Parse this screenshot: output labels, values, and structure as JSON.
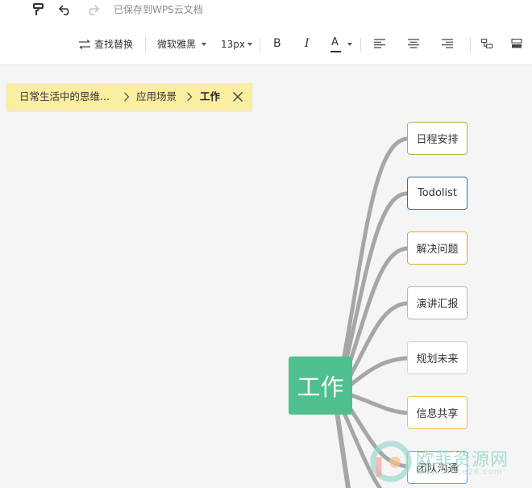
{
  "topbar": {
    "save_status": "已保存到WPS云文档",
    "icons": [
      "format-painter-icon",
      "undo-icon",
      "redo-icon"
    ]
  },
  "toolbar": {
    "find_replace": "查找替换",
    "font_family": "微软雅黑",
    "font_size": "13px",
    "bold": "B",
    "italic": "I",
    "font_color": "A",
    "font_color_value": "#333333"
  },
  "breadcrumb": {
    "items": [
      "日常生活中的思维...",
      "应用场景",
      "工作"
    ]
  },
  "mindmap": {
    "root": "工作",
    "root_color": "#4fc08d",
    "children": [
      {
        "label": "日程安排",
        "color": "#8cc63f"
      },
      {
        "label": "Todolist",
        "color": "#2f6ea5"
      },
      {
        "label": "解决问题",
        "color": "#e3a03a"
      },
      {
        "label": "演讲汇报",
        "color": "#c9a8d8"
      },
      {
        "label": "规划未来",
        "color": "#f3c6c6"
      },
      {
        "label": "信息共享",
        "color": "#f2c14e"
      },
      {
        "label": "团队沟通",
        "color": "#5aa7d8"
      }
    ]
  },
  "watermark": {
    "text": "欧菲资源网",
    "url": "www.office26.com"
  }
}
